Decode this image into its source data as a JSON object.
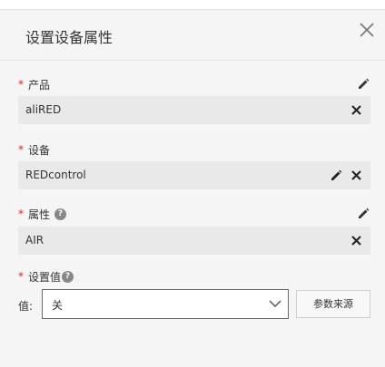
{
  "dialog": {
    "title": "设置设备属性"
  },
  "fields": {
    "product": {
      "label": "产品",
      "value": "aliRED"
    },
    "device": {
      "label": "设备",
      "value": "REDcontrol"
    },
    "property": {
      "label": "属性",
      "value": "AIR"
    },
    "set_value": {
      "label": "设置值",
      "value_label": "值:",
      "selected": "关",
      "source_button": "参数来源"
    }
  },
  "required_mark": "*",
  "help_glyph": "?",
  "icons": {
    "close": "close-icon",
    "edit": "pencil-icon",
    "clear": "x-icon",
    "dropdown": "chevron-down-icon"
  },
  "colors": {
    "required": "#e02020",
    "input_bg": "#e9e9e9",
    "dialog_bg": "#f5f5f5"
  }
}
